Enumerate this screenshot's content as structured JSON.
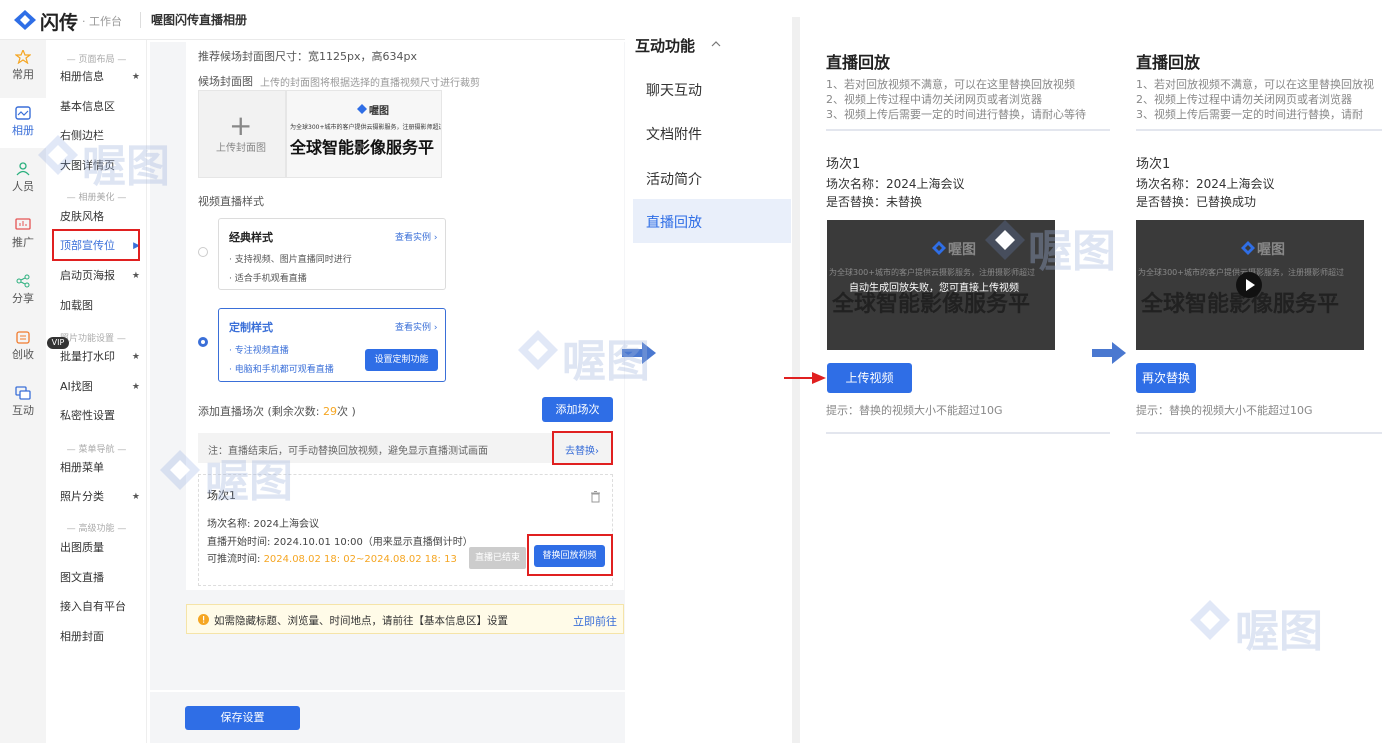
{
  "app": {
    "logo_text": "闪传",
    "logo_sub": "· 工作台",
    "album_title": "喔图闪传直播相册"
  },
  "icon_nav": [
    {
      "label": "常用",
      "icon": "star-icon"
    },
    {
      "label": "相册",
      "icon": "album-icon",
      "active": true
    },
    {
      "label": "人员",
      "icon": "person-icon"
    },
    {
      "label": "推广",
      "icon": "promote-icon"
    },
    {
      "label": "分享",
      "icon": "share-icon"
    },
    {
      "label": "创收",
      "icon": "revenue-icon"
    },
    {
      "label": "互动",
      "icon": "interact-icon"
    }
  ],
  "submenu": {
    "sections": [
      "— 页面布局 —",
      "— 相册美化 —",
      "照片功能设置 —",
      "— 菜单导航 —",
      "— 高级功能 —"
    ],
    "items": [
      {
        "label": "相册信息",
        "star": "★"
      },
      {
        "label": "基本信息区"
      },
      {
        "label": "右侧边栏"
      },
      {
        "label": "大图详情页"
      },
      {
        "label": "皮肤风格"
      },
      {
        "label": "顶部宣传位",
        "star": "▶",
        "active": true
      },
      {
        "label": "启动页海报",
        "star": "★"
      },
      {
        "label": "加载图"
      },
      {
        "label": "批量打水印",
        "star": "★"
      },
      {
        "label": "AI找图",
        "star": "★"
      },
      {
        "label": "私密性设置"
      },
      {
        "label": "相册菜单"
      },
      {
        "label": "照片分类",
        "star": "★"
      },
      {
        "label": "出图质量"
      },
      {
        "label": "图文直播"
      },
      {
        "label": "接入自有平台"
      },
      {
        "label": "相册封面"
      }
    ],
    "vip": "VIP"
  },
  "main": {
    "cover_hint": "推荐候场封面图尺寸：宽1125px，高634px",
    "cover_label": "候场封面图",
    "cover_desc": "上传的封面图将根据选择的直播视频尺寸进行裁剪",
    "upload_cover": "上传封面图",
    "cover_brand": "喔图",
    "cover_small": "为全球300+城市的客户提供云摄影服务，注册摄影师超过",
    "cover_big": "全球智能影像服务平",
    "style_title": "视频直播样式",
    "classic": {
      "title": "经典样式",
      "link": "查看实例 ›",
      "line1": "· 支持视频、图片直播同时进行",
      "line2": "· 适合手机观看直播"
    },
    "custom": {
      "title": "定制样式",
      "link": "查看实例 ›",
      "line1": "· 专注视频直播",
      "line2": "· 电脑和手机都可观看直播",
      "button": "设置定制功能"
    },
    "add_session_label": "添加直播场次 (剩余次数: ",
    "add_session_count": "29",
    "add_session_suffix": "次 )",
    "add_session_button": "添加场次",
    "note": "注：直播结束后，可手动替换回放视频，避免显示直播测试画面",
    "go_replace": "去替换›",
    "session": {
      "title": "场次1",
      "name": "场次名称: 2024上海会议",
      "start": "直播开始时间: 2024.10.01 10:00（用来显示直播倒计时）",
      "push_label": "可推流时间: ",
      "push_value": "2024.08.02 18: 02~2024.08.02 18: 13",
      "ended": "直播已结束",
      "replace": "替换回放视频"
    },
    "tip": "如需隐藏标题、浏览量、时间地点，请前往【基本信息区】设置",
    "tip_link": "立即前往",
    "save": "保存设置"
  },
  "right_menu": {
    "title": "互动功能",
    "items": [
      "聊天互动",
      "文档附件",
      "活动简介",
      "直播回放"
    ],
    "active": 3
  },
  "replay_columns": [
    {
      "title": "直播回放",
      "lines": [
        "1、若对回放视频不满意，可以在这里替换回放视频",
        "2、视频上传过程中请勿关闭网页或者浏览器",
        "3、视频上传后需要一定的时间进行替换，请耐心等待"
      ],
      "session": "场次1",
      "name": "场次名称：2024上海会议",
      "replaced": "是否替换：未替换",
      "overlay": "自动生成回放失败，您可直接上传视频",
      "button": "上传视频",
      "hint": "提示：替换的视频大小不能超过10G"
    },
    {
      "title": "直播回放",
      "lines": [
        "1、若对回放视频不满意，可以在这里替换回放视",
        "2、视频上传过程中请勿关闭网页或者浏览器",
        "3、视频上传后需要一定的时间进行替换，请耐"
      ],
      "session": "场次1",
      "name": "场次名称：2024上海会议",
      "replaced": "是否替换：已替换成功",
      "overlay": "",
      "button": "再次替换",
      "hint": "提示：替换的视频大小不能超过10G"
    }
  ],
  "video_brand": "喔图",
  "video_small": "为全球300+城市的客户提供云摄影服务，注册摄影师超过",
  "video_big": "全球智能影像服务平",
  "watermark": "喔图",
  "colors": {
    "accent": "#2f6ee6",
    "highlight": "#e02020",
    "warn": "#f5a623"
  }
}
